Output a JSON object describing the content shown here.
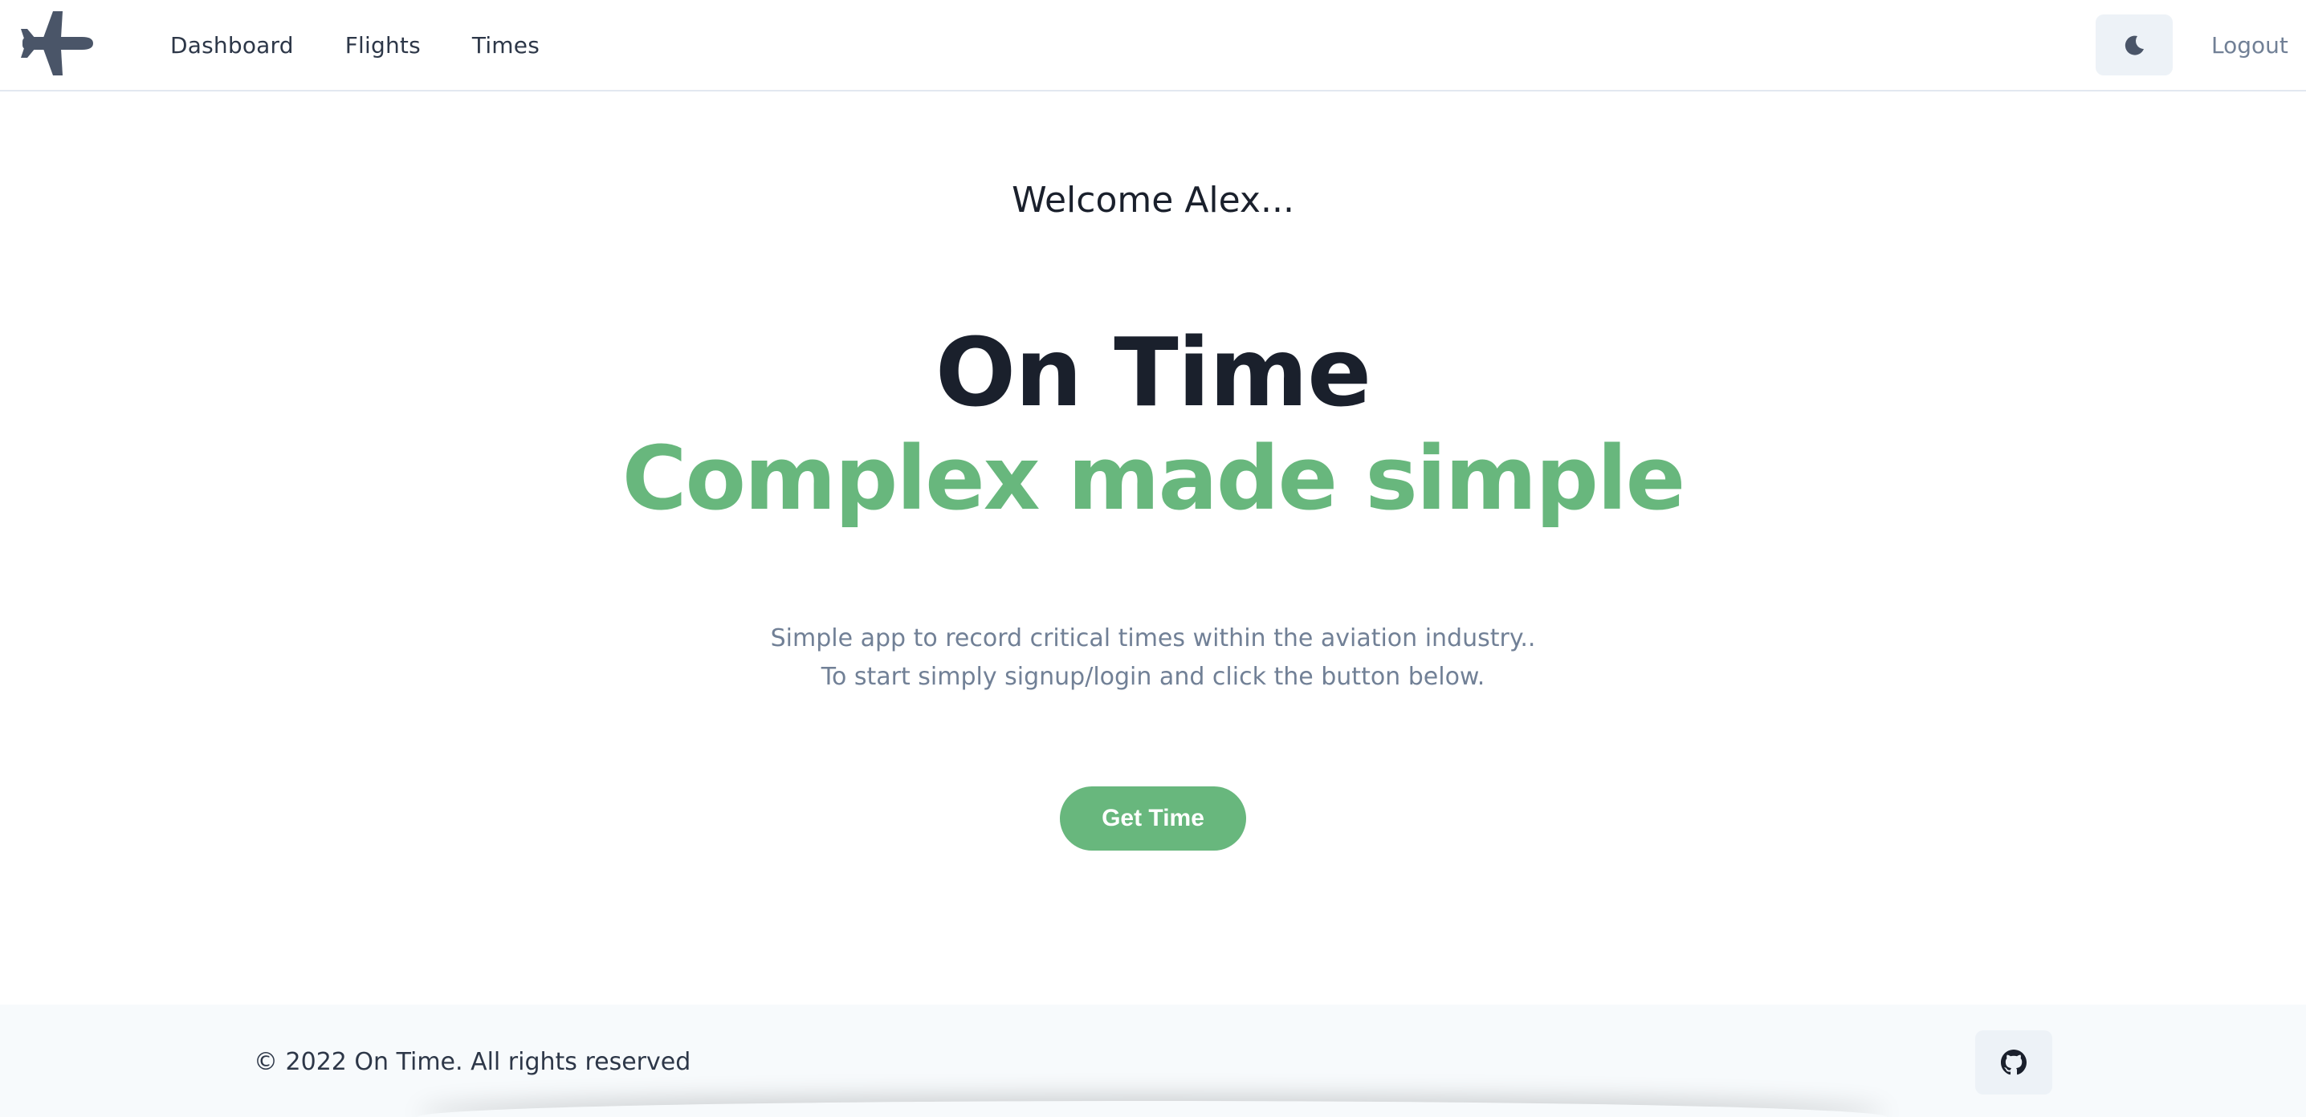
{
  "navbar": {
    "logo_icon": "airplane-icon",
    "links": [
      {
        "label": "Dashboard"
      },
      {
        "label": "Flights"
      },
      {
        "label": "Times"
      }
    ],
    "theme_toggle_icon": "moon-icon",
    "logout_label": "Logout"
  },
  "hero": {
    "welcome": "Welcome Alex...",
    "title": "On Time",
    "subtitle": "Complex made simple",
    "description": [
      "Simple app to record critical times within the aviation industry..",
      "To start simply signup/login and click the button below."
    ],
    "cta_label": "Get Time"
  },
  "footer": {
    "copyright": "© 2022 On Time. All rights reserved",
    "github_icon": "github-icon"
  },
  "colors": {
    "accent_green": "#68b77d",
    "text_dark": "#1a202c",
    "text_muted": "#718096",
    "icon_slate": "#4a5568",
    "button_bg": "#edf2f7",
    "footer_bg": "#f7fafc"
  }
}
